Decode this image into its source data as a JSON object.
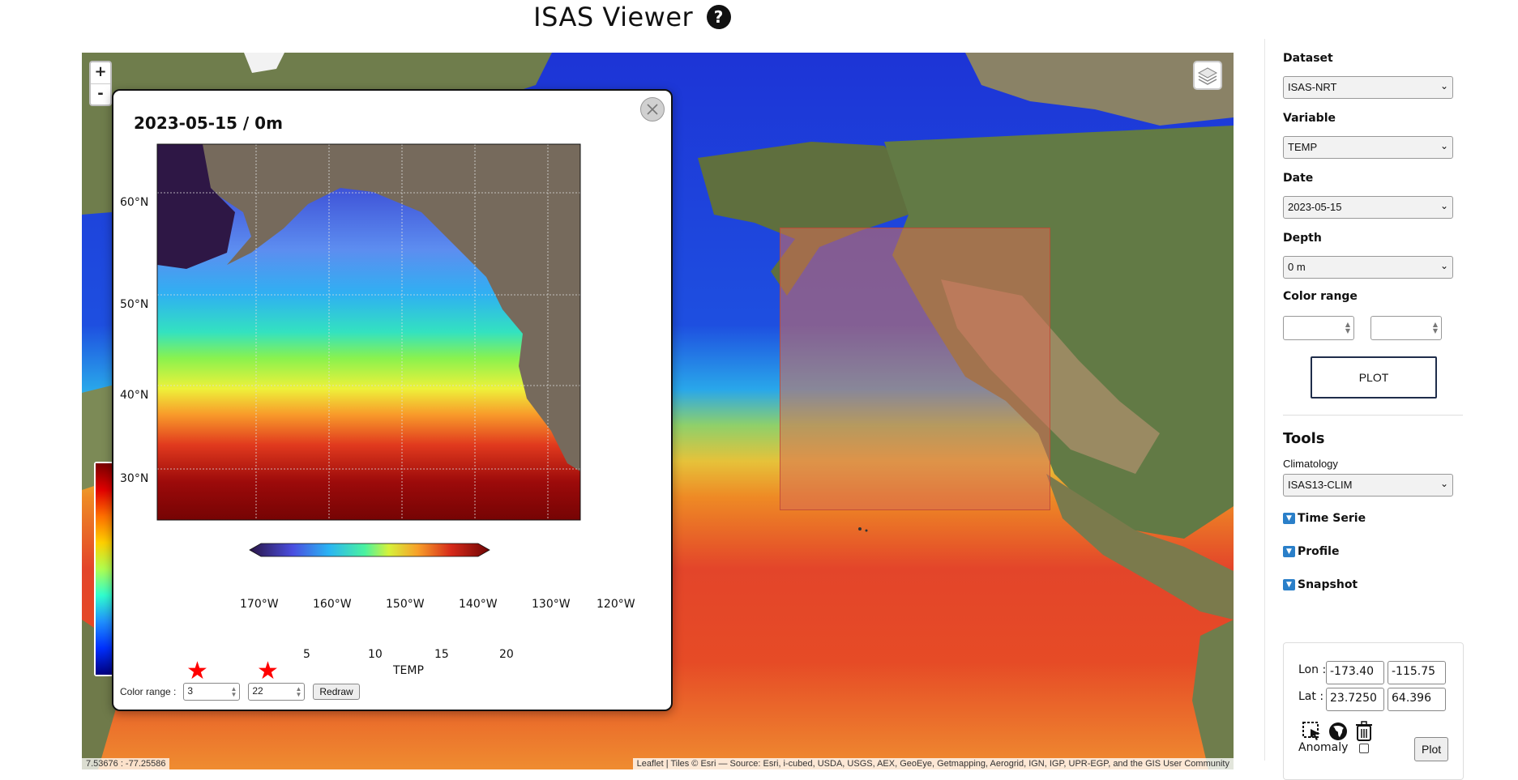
{
  "header": {
    "title": "ISAS Viewer",
    "help_icon": "question-circle-icon"
  },
  "map": {
    "zoom_in_label": "+",
    "zoom_out_label": "-",
    "layers_icon": "layers-icon",
    "cursor_coords": "7.53676 : -77.25586",
    "attribution": "Leaflet | Tiles © Esri — Source: Esri, i-cubed, USDA, USGS, AEX, GeoEye, Getmapping, Aerogrid, IGN, IGP, UPR-EGP, and the GIS User Community"
  },
  "popup": {
    "title": "2023-05-15 / 0m",
    "close_icon": "close-icon",
    "lat_ticks": [
      "60°N",
      "50°N",
      "40°N",
      "30°N"
    ],
    "lon_ticks": [
      "170°W",
      "160°W",
      "150°W",
      "140°W",
      "130°W",
      "120°W"
    ],
    "colorbar_ticks": [
      "5",
      "10",
      "15",
      "20"
    ],
    "colorbar_label": "TEMP",
    "color_range_label": "Color range :",
    "range_min": "3",
    "range_max": "22",
    "redraw_label": "Redraw",
    "marker_icon": "star-marker-icon"
  },
  "sidebar": {
    "dataset_label": "Dataset",
    "dataset_value": "ISAS-NRT",
    "variable_label": "Variable",
    "variable_value": "TEMP",
    "date_label": "Date",
    "date_value": "2023-05-15",
    "depth_label": "Depth",
    "depth_value": "0 m",
    "color_range_label": "Color range",
    "color_range_min": "",
    "color_range_max": "",
    "plot_label": "PLOT",
    "tools_title": "Tools",
    "climatology_label": "Climatology",
    "climatology_value": "ISAS13-CLIM",
    "time_serie_label": "Time Serie",
    "profile_label": "Profile",
    "snapshot_label": "Snapshot",
    "snapshot": {
      "lon_label": "Lon :",
      "lat_label": "Lat :",
      "lon_min": "-173.40",
      "lon_max": "-115.75",
      "lat_min": "23.7250",
      "lat_max": "64.396",
      "select_icon": "selection-cursor-icon",
      "globe_icon": "globe-icon",
      "trash_icon": "trash-icon",
      "anomaly_label": "Anomaly",
      "anomaly_checked": false,
      "plot_label": "Plot"
    }
  },
  "colors": {
    "accent": "#1f2d4a",
    "toggle_blue": "#2a7fc9",
    "marker_red": "#ff0000"
  }
}
